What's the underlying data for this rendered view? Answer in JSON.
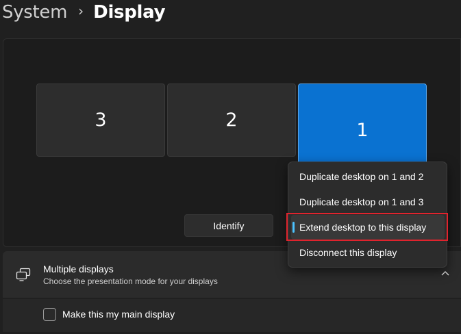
{
  "breadcrumb": {
    "parent": "System",
    "separator": "›",
    "current": "Display"
  },
  "arrangement": {
    "monitors": [
      {
        "label": "3"
      },
      {
        "label": "2"
      },
      {
        "label": "1",
        "selected": true
      }
    ],
    "identify_label": "Identify"
  },
  "multiple_displays": {
    "icon": "multiple-displays-icon",
    "title": "Multiple displays",
    "subtitle": "Choose the presentation mode for your displays",
    "expanded": true
  },
  "main_display": {
    "label": "Make this my main display",
    "checked": false
  },
  "menu": {
    "items": [
      {
        "label": "Duplicate desktop on 1 and 2"
      },
      {
        "label": "Duplicate desktop on 1 and 3"
      },
      {
        "label": "Extend desktop to this display",
        "selected": true
      },
      {
        "label": "Disconnect this display"
      }
    ]
  },
  "colors": {
    "accent": "#0a72d1",
    "selection_indicator": "#4cc2ff",
    "highlight_outline": "#e0232d",
    "background": "#202020"
  }
}
